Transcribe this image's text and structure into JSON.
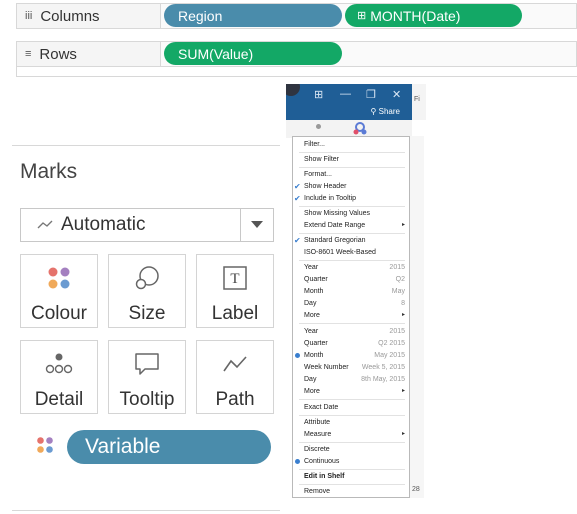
{
  "shelves": {
    "columns": {
      "label": "Columns",
      "pills": [
        "Region",
        "MONTH(Date)"
      ]
    },
    "rows": {
      "label": "Rows",
      "pills": [
        "SUM(Value)"
      ]
    }
  },
  "marks": {
    "title": "Marks",
    "type_label": "Automatic",
    "tiles": {
      "colour": "Colour",
      "size": "Size",
      "label": "Label",
      "detail": "Detail",
      "tooltip": "Tooltip",
      "path": "Path"
    },
    "variable_pill": "Variable"
  },
  "window": {
    "share_label": "Share",
    "side_fragment": "Fi",
    "side_num": "28"
  },
  "menu": {
    "filter": "Filter...",
    "show_filter": "Show Filter",
    "format": "Format...",
    "show_header": "Show Header",
    "include_in_tooltip": "Include in Tooltip",
    "show_missing_values": "Show Missing Values",
    "extend_date_range": "Extend Date Range",
    "standard_gregorian": "Standard Gregorian",
    "iso_week": "ISO-8601 Week-Based",
    "discrete": {
      "year": {
        "label": "Year",
        "value": "2015"
      },
      "quarter": {
        "label": "Quarter",
        "value": "Q2"
      },
      "month": {
        "label": "Month",
        "value": "May"
      },
      "day": {
        "label": "Day",
        "value": "8"
      },
      "more": "More"
    },
    "continuous": {
      "year": {
        "label": "Year",
        "value": "2015"
      },
      "quarter": {
        "label": "Quarter",
        "value": "Q2 2015"
      },
      "month": {
        "label": "Month",
        "value": "May 2015"
      },
      "week": {
        "label": "Week Number",
        "value": "Week 5, 2015"
      },
      "day": {
        "label": "Day",
        "value": "8th May, 2015"
      },
      "more": "More"
    },
    "exact_date": "Exact Date",
    "attribute": "Attribute",
    "measure": "Measure",
    "discrete_opt": "Discrete",
    "continuous_opt": "Continuous",
    "edit_in_shelf": "Edit in Shelf",
    "remove": "Remove"
  }
}
